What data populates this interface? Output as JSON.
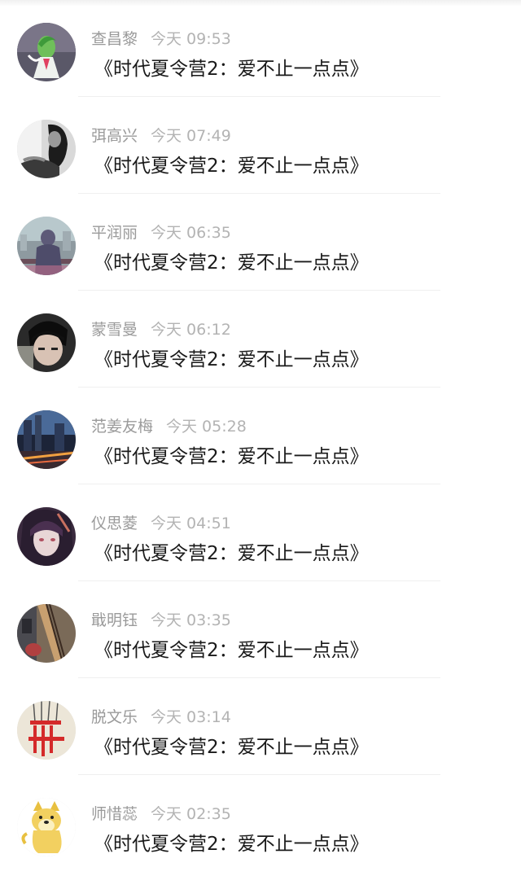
{
  "comments": [
    {
      "name": "查昌黎",
      "time": "今天 09:53",
      "text": "《时代夏令营2：爱不止一点点》",
      "avatar_icon": "green-anime-character-avatar"
    },
    {
      "name": "弭高兴",
      "time": "今天 07:49",
      "text": "《时代夏令营2：爱不止一点点》",
      "avatar_icon": "black-white-woman-portrait-avatar"
    },
    {
      "name": "平润丽",
      "time": "今天 06:35",
      "text": "《时代夏令营2：爱不止一点点》",
      "avatar_icon": "city-skyline-girl-avatar"
    },
    {
      "name": "蒙雪曼",
      "time": "今天 06:12",
      "text": "《时代夏令营2：爱不止一点点》",
      "avatar_icon": "boy-face-avatar"
    },
    {
      "name": "范姜友梅",
      "time": "今天 05:28",
      "text": "《时代夏令营2：爱不止一点点》",
      "avatar_icon": "night-city-avatar"
    },
    {
      "name": "仪思菱",
      "time": "今天 04:51",
      "text": "《时代夏令营2：爱不止一点点》",
      "avatar_icon": "anime-dark-hair-avatar"
    },
    {
      "name": "戢明钰",
      "time": "今天 03:35",
      "text": "《时代夏令营2：爱不止一点点》",
      "avatar_icon": "guitar-closeup-avatar"
    },
    {
      "name": "脱文乐",
      "time": "今天 03:14",
      "text": "《时代夏令营2：爱不止一点点》",
      "avatar_icon": "red-ornaments-avatar"
    },
    {
      "name": "师惜蕊",
      "time": "今天 02:35",
      "text": "《时代夏令营2：爱不止一点点》",
      "avatar_icon": "shiba-doge-avatar"
    }
  ]
}
